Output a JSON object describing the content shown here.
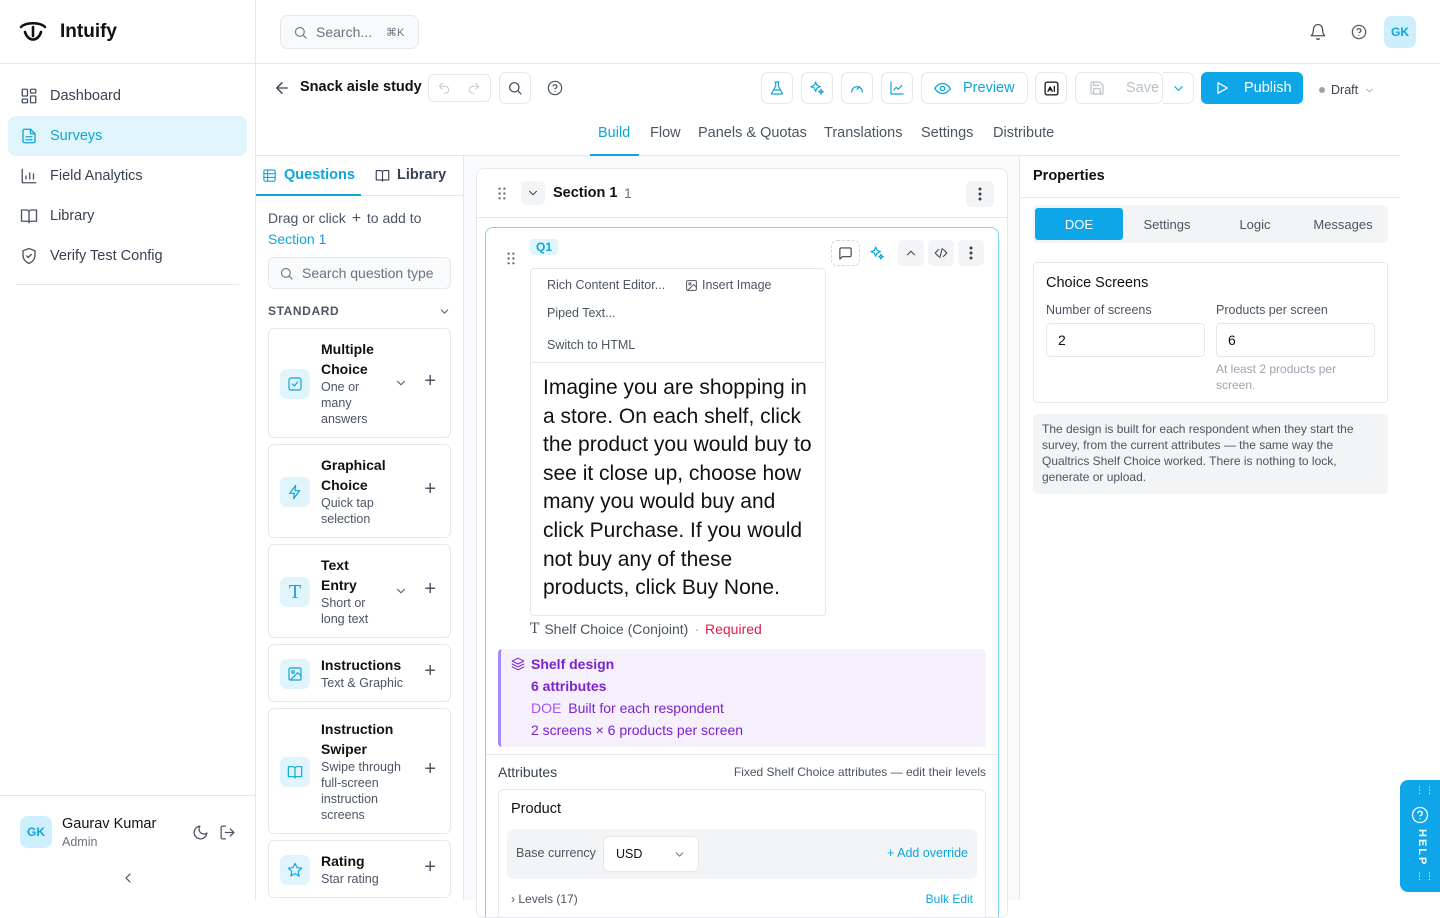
{
  "app": {
    "name": "Intuify"
  },
  "sidebar": {
    "items": [
      {
        "label": "Dashboard",
        "icon": "grid-icon"
      },
      {
        "label": "Surveys",
        "icon": "document-icon"
      },
      {
        "label": "Field Analytics",
        "icon": "bar-chart-icon"
      },
      {
        "label": "Library",
        "icon": "book-icon"
      },
      {
        "label": "Verify Test Config",
        "icon": "shield-icon"
      }
    ],
    "user": {
      "initials": "GK",
      "name": "Gaurav Kumar",
      "role": "Admin"
    }
  },
  "topbar": {
    "search_placeholder": "Search...",
    "shortcut": "⌘K",
    "user_initials": "GK"
  },
  "survey": {
    "title": "Snack aisle study",
    "preview_label": "Preview",
    "save_label": "Save",
    "publish_label": "Publish",
    "status": "Draft",
    "tabs": [
      "Build",
      "Flow",
      "Panels & Quotas",
      "Translations",
      "Settings",
      "Distribute"
    ]
  },
  "questions_panel": {
    "tab_questions": "Questions",
    "tab_library": "Library",
    "hint_prefix": "Drag or click",
    "hint_suffix": "to add to",
    "hint_target": "Section 1",
    "search_placeholder": "Search question type",
    "group_label": "STANDARD",
    "types": [
      {
        "title": "Multiple Choice",
        "subtitle": "One or many answers"
      },
      {
        "title": "Graphical Choice",
        "subtitle": "Quick tap selection"
      },
      {
        "title": "Text Entry",
        "subtitle": "Short or long text"
      },
      {
        "title": "Instructions",
        "subtitle": "Text & Graphic"
      },
      {
        "title": "Instruction Swiper",
        "subtitle": "Swipe through full-screen instruction screens"
      },
      {
        "title": "Rating",
        "subtitle": "Star rating"
      }
    ]
  },
  "canvas": {
    "section_title": "Section 1",
    "section_count": "1",
    "question": {
      "number": "Q1",
      "toolbar": [
        "Rich Content Editor...",
        "Insert Image",
        "Piped Text...",
        "Switch to HTML"
      ],
      "text": "Imagine you are shopping in a store. On each shelf, click the product you would buy to see it close up, choose how many you would buy and click Purchase. If you would not buy any of these products, click Buy None.",
      "type_label": "Shelf Choice (Conjoint)",
      "separator": "·",
      "required_label": "Required",
      "design": {
        "title": "Shelf design",
        "attributes": "6 attributes",
        "doe_tag": "DOE",
        "doe_text": "Built for each respondent",
        "screens": "2 screens × 6 products per screen"
      },
      "attributes_label": "Attributes",
      "attributes_note": "Fixed Shelf Choice attributes — edit their levels",
      "product_label": "Product",
      "base_currency_label": "Base currency",
      "currency": "USD",
      "add_override": "+ Add override",
      "levels_label": "Levels (17)",
      "bulk_edit": "Bulk Edit"
    }
  },
  "properties": {
    "title": "Properties",
    "tabs": [
      "DOE",
      "Settings",
      "Logic",
      "Messages"
    ],
    "choice_screens": {
      "title": "Choice Screens",
      "screens_label": "Number of screens",
      "screens_value": "2",
      "products_label": "Products per screen",
      "products_value": "6",
      "products_help": "At least 2 products per screen."
    },
    "info_text": "The design is built for each respondent when they start the survey, from the current attributes — the same way the Qualtrics Shelf Choice worked. There is nothing to lock, generate or upload."
  },
  "help_tab": {
    "label": "HELP"
  },
  "colors": {
    "accent": "#0ea5d8",
    "purple": "#7e22ce",
    "required": "#e11d48"
  }
}
